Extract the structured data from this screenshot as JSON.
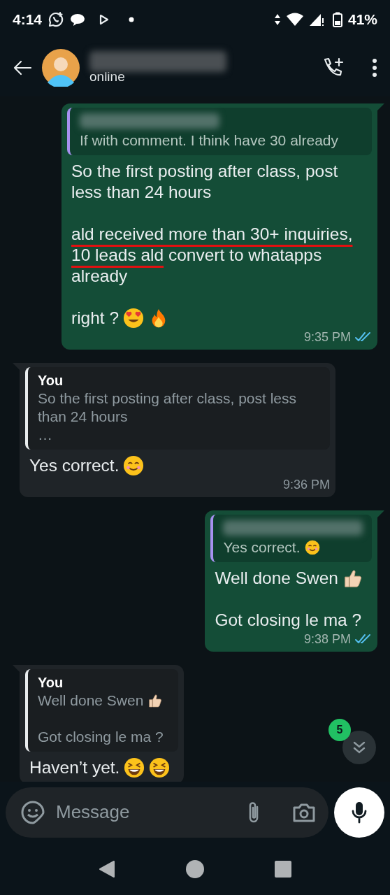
{
  "status_bar": {
    "time": "4:14",
    "battery": "41%"
  },
  "header": {
    "name_redacted": true,
    "status": "online"
  },
  "messages": [
    {
      "outgoing": true,
      "quote": {
        "author_redacted": true,
        "paragraphs": [
          [
            {
              "kind": "text",
              "text": "If with comment. I think have 30 already"
            }
          ]
        ]
      },
      "paragraphs": [
        [
          {
            "kind": "text",
            "text": "So the first posting after class, post less than 24 hours"
          }
        ],
        [
          {
            "kind": "underlined",
            "text": "ald received more than 30+ inquiries, "
          },
          {
            "kind": "underlined",
            "text": "10 leads ald"
          },
          {
            "kind": "text",
            "text": "  convert to whatapps already"
          }
        ],
        [
          {
            "kind": "text",
            "text": "right ?"
          },
          {
            "kind": "heart-eyes"
          },
          {
            "kind": "fire"
          }
        ]
      ],
      "time": "9:35 PM",
      "read": true
    },
    {
      "outgoing": false,
      "quote": {
        "author": "You",
        "paragraphs": [
          [
            {
              "kind": "text",
              "text": "So the first posting after class, post less than 24 hours"
            }
          ]
        ],
        "ellipsis": "…"
      },
      "paragraphs": [
        [
          {
            "kind": "text",
            "text": "Yes correct."
          },
          {
            "kind": "smile"
          }
        ]
      ],
      "time": "9:36 PM"
    },
    {
      "outgoing": true,
      "quote": {
        "author_redacted": true,
        "paragraphs": [
          [
            {
              "kind": "text",
              "text": "Yes correct."
            },
            {
              "kind": "smile"
            }
          ]
        ]
      },
      "paragraphs": [
        [
          {
            "kind": "text",
            "text": "Well done Swen"
          },
          {
            "kind": "thumbs-up"
          }
        ],
        [
          {
            "kind": "text",
            "text": "Got closing le ma ?"
          }
        ]
      ],
      "time": "9:38 PM",
      "read": true
    },
    {
      "outgoing": false,
      "quote": {
        "author": "You",
        "paragraphs": [
          [
            {
              "kind": "text",
              "text": "Well done Swen"
            },
            {
              "kind": "thumbs-up"
            }
          ],
          [
            {
              "kind": "text",
              "text": "Got closing le ma ?"
            }
          ]
        ]
      },
      "paragraphs": [
        [
          {
            "kind": "text",
            "text": "Haven’t yet."
          },
          {
            "kind": "laughing"
          },
          {
            "kind": "laughing"
          }
        ]
      ]
    }
  ],
  "scroll_button": {
    "unread": "5"
  },
  "composer": {
    "placeholder": "Message"
  }
}
